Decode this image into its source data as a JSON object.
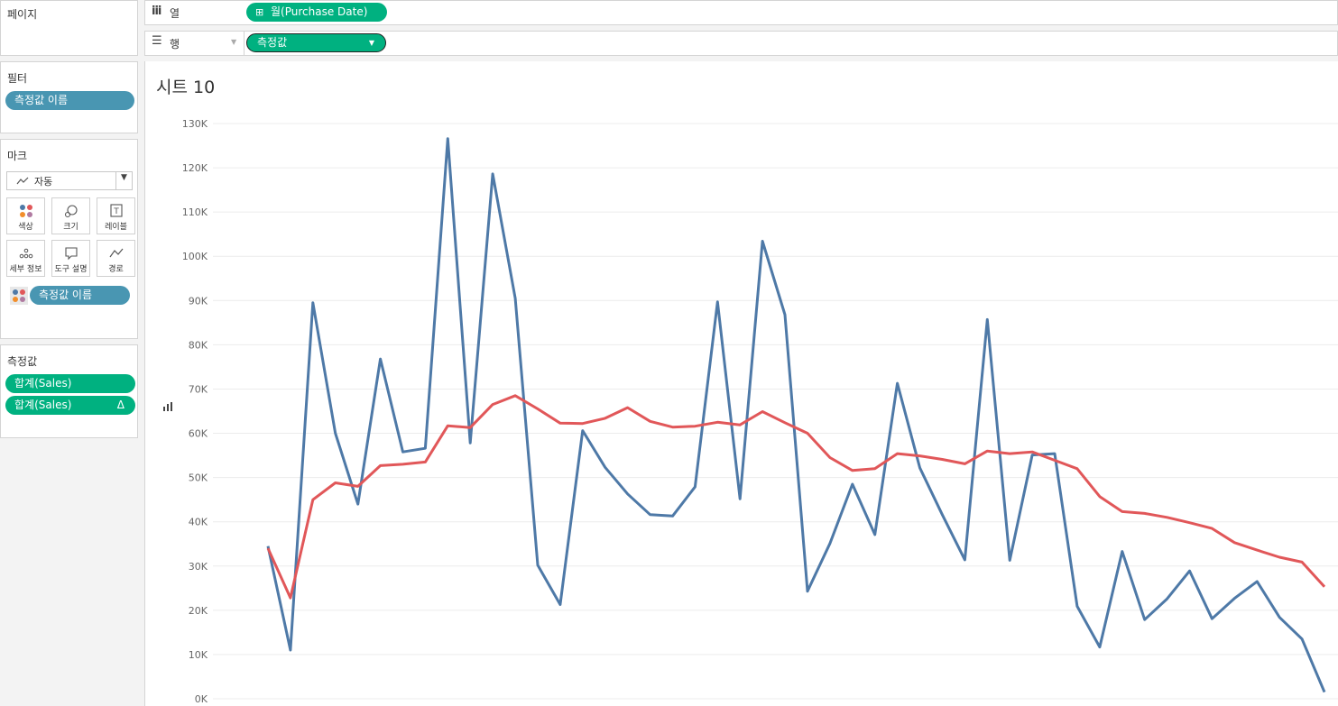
{
  "pages_panel": {
    "title": "페이지"
  },
  "filters_panel": {
    "title": "필터",
    "pill": "측정값 이름"
  },
  "marks_panel": {
    "title": "마크",
    "mark_type": "자동",
    "buttons": {
      "color": "색상",
      "size": "크기",
      "label": "레이블",
      "detail": "세부 정보",
      "tooltip": "도구 설명",
      "path": "경로"
    },
    "color_pill": "측정값 이름"
  },
  "measures_panel": {
    "title": "측정값",
    "items": [
      "합계(Sales)",
      "합계(Sales)"
    ],
    "delta_symbol": "Δ"
  },
  "columns_shelf": {
    "label": "열",
    "pill": "월(Purchase Date)",
    "pill_prefix": "⊞"
  },
  "rows_shelf": {
    "label": "행",
    "pill": "측정값"
  },
  "sheet": {
    "title": "시트 10",
    "axis_icon_text": "ᅟ"
  },
  "colors": {
    "accent_green": "#00b180",
    "pill_blue": "#4996b2",
    "series_blue": "#4e79a7",
    "series_red": "#e15759"
  },
  "chart_data": {
    "type": "line",
    "ylim": [
      0,
      130000
    ],
    "yticks": [
      "0K",
      "10K",
      "20K",
      "30K",
      "40K",
      "50K",
      "60K",
      "70K",
      "80K",
      "90K",
      "100K",
      "110K",
      "120K",
      "130K"
    ],
    "grid": true,
    "series": [
      {
        "color": "#4e79a7",
        "values": [
          34500,
          11000,
          89500,
          60000,
          44000,
          76800,
          55800,
          56600,
          126600,
          57800,
          118600,
          90500,
          30200,
          21300,
          60600,
          52300,
          46300,
          41600,
          41300,
          47900,
          89700,
          45200,
          103400,
          86800,
          24300,
          35100,
          48500,
          37100,
          71300,
          52200,
          41600,
          31400,
          85700,
          31300,
          55100,
          55400,
          20900,
          11700,
          33300,
          17900,
          22600,
          28900,
          18100,
          22700,
          26500,
          18400,
          13500,
          1500
        ]
      },
      {
        "color": "#e15759",
        "values": [
          34000,
          22800,
          45000,
          48800,
          48000,
          52700,
          53000,
          53500,
          61700,
          61300,
          66500,
          68500,
          65500,
          62300,
          62200,
          63400,
          65800,
          62700,
          61400,
          61600,
          62500,
          61900,
          64900,
          62400,
          60000,
          54500,
          51600,
          52000,
          55400,
          54900,
          54100,
          53100,
          56000,
          55400,
          55800,
          53900,
          52000,
          45700,
          42300,
          41900,
          41000,
          39800,
          38500,
          35300,
          33600,
          32000,
          30900,
          25300
        ]
      }
    ]
  }
}
